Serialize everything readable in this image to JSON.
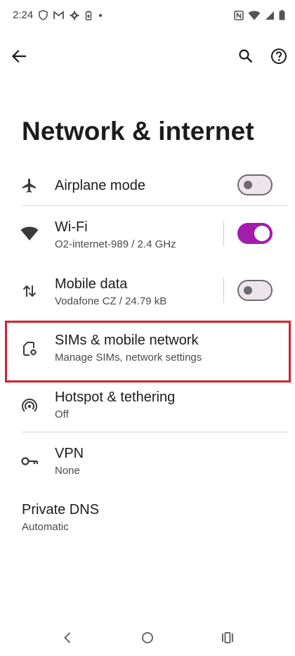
{
  "status_bar": {
    "time": "2:24",
    "left_icons": [
      "shield-icon",
      "gmail-icon",
      "settings-gear-icon",
      "battery-saver-icon",
      "dot-icon"
    ],
    "right_icons": [
      "nfc-icon",
      "wifi-signal-icon",
      "cell-signal-icon",
      "battery-icon"
    ]
  },
  "toolbar": {
    "back_icon": "arrow-left-icon",
    "search_icon": "search-icon",
    "help_icon": "help-circle-icon"
  },
  "page": {
    "title": "Network & internet"
  },
  "items": [
    {
      "title": "Airplane mode",
      "subtitle": "",
      "icon": "airplane-icon",
      "toggle": "off"
    },
    {
      "title": "Wi‑Fi",
      "subtitle": "O2-internet-989 / 2.4 GHz",
      "icon": "wifi-icon",
      "toggle": "on"
    },
    {
      "title": "Mobile data",
      "subtitle": "Vodafone CZ / 24.79 kB",
      "icon": "mobile-data-arrows-icon",
      "toggle": "off"
    },
    {
      "title": "SIMs & mobile network",
      "subtitle": "Manage SIMs, network settings",
      "icon": "sim-settings-icon"
    },
    {
      "title": "Hotspot & tethering",
      "subtitle": "Off",
      "icon": "hotspot-icon"
    },
    {
      "title": "VPN",
      "subtitle": "None",
      "icon": "vpn-key-icon"
    },
    {
      "title": "Private DNS",
      "subtitle": "Automatic"
    }
  ],
  "colors": {
    "accent": "#a21cae",
    "highlight_border": "#d8202e",
    "text_primary": "#1c1b1f",
    "text_secondary": "#4a4a4a"
  },
  "nav_bar": {
    "back_icon": "nav-back-icon",
    "home_icon": "nav-home-icon",
    "recents_icon": "nav-recents-icon"
  }
}
